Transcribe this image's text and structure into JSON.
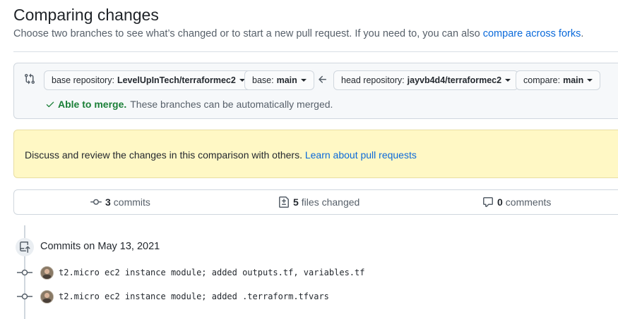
{
  "header": {
    "title": "Comparing changes",
    "subtitle_text": "Choose two branches to see what’s changed or to start a new pull request. If you need to, you can also",
    "subtitle_link": "compare across forks",
    "subtitle_end": "."
  },
  "range": {
    "base_repo_label": "base repository:",
    "base_repo_value": "LevelUpInTech/terraformec2",
    "base_label": "base:",
    "base_value": "main",
    "head_repo_label": "head repository:",
    "head_repo_value": "jayvb4d4/terraformec2",
    "compare_label": "compare:",
    "compare_value": "main",
    "merge_ok": "Able to merge.",
    "merge_text": "These branches can be automatically merged."
  },
  "flash": {
    "text": "Discuss and review the changes in this comparison with others.",
    "link": "Learn about pull requests"
  },
  "summary": {
    "commits_count": "3",
    "commits_label": "commits",
    "files_count": "5",
    "files_label": "files changed",
    "comments_count": "0",
    "comments_label": "comments"
  },
  "commits": {
    "day_label": "Commits on May 13, 2021",
    "items": [
      {
        "message": "t2.micro ec2 instance module; added outputs.tf, variables.tf"
      },
      {
        "message": "t2.micro ec2 instance module; added .terraform.tfvars"
      }
    ]
  },
  "colors": {
    "link": "#0969da",
    "success": "#1a7f37",
    "flash_bg": "#fff8c5"
  }
}
